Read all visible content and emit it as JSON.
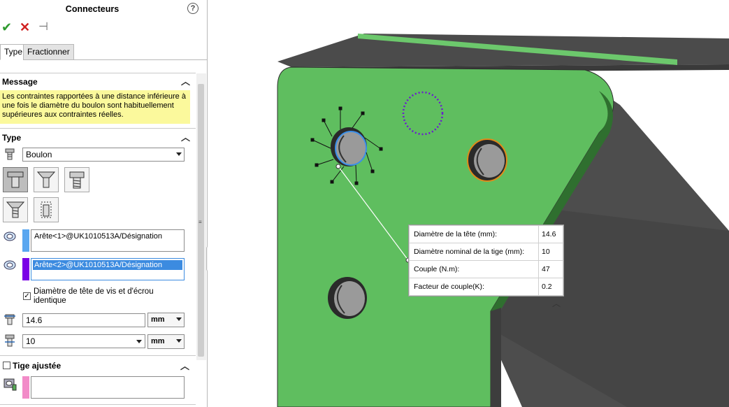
{
  "panel": {
    "title": "Connecteurs",
    "help_glyph": "?",
    "ok_glyph": "✔",
    "cancel_glyph": "✕",
    "pin_glyph": "⊣",
    "tabs": [
      {
        "label": "Type"
      },
      {
        "label": "Fractionner"
      }
    ],
    "message": {
      "header": "Message",
      "text": "Les contraintes rapportées à une distance inférieure à une fois le diamètre du boulon sont habituellement supérieures aux contraintes réelles."
    },
    "type_section": {
      "header": "Type",
      "selected_type": "Boulon",
      "selection1": "Arête<1>@UK1010513A/Désignation",
      "selection2": "Arête<2>@UK1010513A/Désignation",
      "same_head_checkbox_label": "Diamètre de tête de vis et d'écrou identique",
      "same_head_checked": true,
      "head_diameter": "14.6",
      "head_unit": "mm",
      "shank_diameter": "10",
      "shank_unit": "mm"
    },
    "fitted_section": {
      "header": "Tige ajustée",
      "checked": false
    },
    "colors": {
      "sel1": "#5aa7f0",
      "sel2": "#7a00e6",
      "fitted": "#f28bc8",
      "message_bg": "#fbf99c",
      "ok": "#2e9a2e",
      "cancel": "#d02020"
    }
  },
  "callout": {
    "rows": [
      {
        "label": "Diamètre de la tête (mm):",
        "value": "14.6"
      },
      {
        "label": "Diamètre nominal de la tige (mm):",
        "value": "10"
      },
      {
        "label": "Couple (N.m):",
        "value": "47"
      },
      {
        "label": "Facteur de couple(K):",
        "value": "0.2"
      }
    ]
  },
  "viewport_colors": {
    "plate": "#5fbe5f",
    "dark": "#505050",
    "highlight1": "#3a8fe8",
    "highlight2": "#e08a1a",
    "pending": "#6a1bd0"
  }
}
